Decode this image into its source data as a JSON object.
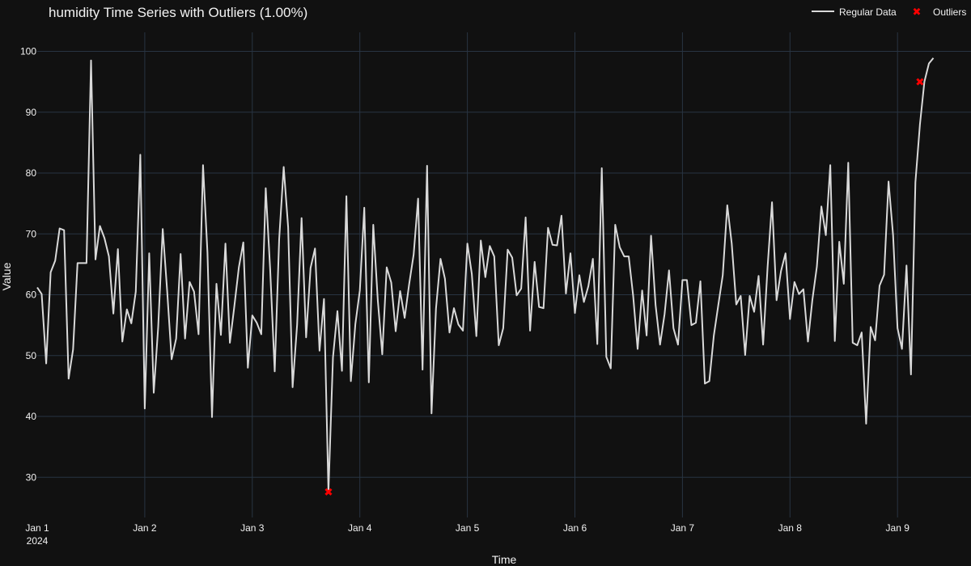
{
  "chart_data": {
    "type": "line",
    "title": "humidity Time Series with Outliers (1.00%)",
    "xlabel": "Time",
    "ylabel": "Value",
    "x_ticks": [
      {
        "label": "Jan 1",
        "sub": "2024",
        "value": 0
      },
      {
        "label": "Jan 2",
        "value": 1
      },
      {
        "label": "Jan 3",
        "value": 2
      },
      {
        "label": "Jan 4",
        "value": 3
      },
      {
        "label": "Jan 5",
        "value": 4
      },
      {
        "label": "Jan 6",
        "value": 5
      },
      {
        "label": "Jan 7",
        "value": 6
      },
      {
        "label": "Jan 8",
        "value": 7
      },
      {
        "label": "Jan 9",
        "value": 8
      }
    ],
    "y_ticks": [
      30,
      40,
      50,
      60,
      70,
      80,
      90,
      100
    ],
    "xlim": [
      0,
      8.75
    ],
    "ylim": [
      23,
      103
    ],
    "grid": true,
    "legend_position": "top-right",
    "colors": {
      "background": "#111111",
      "grid": "#283442",
      "line": "#d9d9d9",
      "outlier": "#ff0000",
      "text": "#f2f2f2"
    },
    "series": [
      {
        "name": "Regular Data",
        "type": "line",
        "x_step_hours": 1,
        "values": [
          61.2,
          60.1,
          48.7,
          63.7,
          65.6,
          70.9,
          70.6,
          46.2,
          51,
          65.2,
          65.2,
          65.2,
          98.5,
          65.8,
          71.3,
          69.3,
          66.3,
          56.9,
          67.5,
          52.3,
          57.6,
          55.3,
          60.5,
          83,
          41.3,
          66.8,
          43.9,
          54.7,
          70.8,
          60.6,
          49.4,
          52.8,
          66.7,
          52.8,
          62.1,
          60.5,
          53.5,
          81.3,
          66.9,
          39.9,
          61.8,
          53.4,
          68.4,
          52.1,
          58.1,
          64.5,
          68.6,
          48,
          56.6,
          55.4,
          53.5,
          77.5,
          64.1,
          47.4,
          69.1,
          81,
          71.1,
          44.8,
          55.1,
          72.6,
          53,
          64.4,
          67.6,
          50.8,
          59.3,
          27.6,
          49.7,
          57.3,
          47.5,
          76.2,
          45.8,
          55.2,
          60.7,
          74.3,
          45.6,
          71.5,
          59.1,
          50.2,
          64.5,
          62,
          54,
          60.6,
          56.2,
          61.7,
          66.6,
          75.8,
          47.7,
          81.2,
          40.5,
          57.7,
          65.9,
          62.6,
          53.8,
          57.8,
          55.1,
          54.1,
          68.4,
          63.4,
          53.2,
          68.9,
          62.9,
          68,
          66.3,
          51.7,
          54.5,
          67.4,
          66.1,
          59.9,
          61,
          72.7,
          54.1,
          65.4,
          58,
          57.8,
          71,
          68.2,
          68.1,
          73,
          60.2,
          66.8,
          57,
          63.2,
          58.8,
          61.4,
          65.9,
          51.9,
          80.8,
          49.8,
          47.9,
          71.5,
          67.8,
          66.3,
          66.3,
          59.8,
          51.1,
          60.7,
          53.3,
          69.7,
          58.3,
          51.8,
          56.8,
          64,
          54.5,
          51.8,
          62.4,
          62.4,
          55,
          55.4,
          62.2,
          45.4,
          45.8,
          53.3,
          58.3,
          63.2,
          74.7,
          68.4,
          58.4,
          59.8,
          50.1,
          59.8,
          57.2,
          63.1,
          51.8,
          64.5,
          75.2,
          59.1,
          63.9,
          66.8,
          56,
          62.1,
          60.1,
          60.9,
          52.3,
          59.2,
          64.6,
          74.5,
          69.8,
          81.3,
          52.4,
          68.7,
          61.8,
          81.7,
          52.1,
          51.7,
          53.8,
          38.8,
          54.7,
          52.5,
          61.5,
          63.3,
          78.6,
          69.8,
          54.5,
          51.1,
          64.8,
          46.9,
          78.5,
          88,
          95,
          98,
          98.9
        ]
      },
      {
        "name": "Outliers",
        "type": "scatter",
        "marker": "x",
        "points": [
          {
            "x_hours": 65,
            "y": 27.6
          },
          {
            "x_hours": 197,
            "y": 95
          }
        ]
      }
    ]
  }
}
